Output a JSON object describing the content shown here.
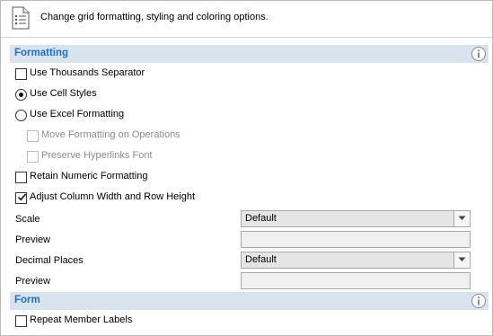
{
  "header": {
    "description": "Change grid formatting, styling and coloring options.",
    "icon": "document-list-icon"
  },
  "formatting": {
    "title": "Formatting",
    "info_icon": "info-icon",
    "options": {
      "thousands_separator": {
        "label": "Use Thousands Separator",
        "checked": false
      },
      "cell_styles": {
        "label": "Use Cell Styles",
        "selected": true
      },
      "excel_formatting": {
        "label": "Use Excel Formatting",
        "selected": false
      },
      "move_formatting": {
        "label": "Move Formatting on Operations",
        "checked": false,
        "enabled": false
      },
      "preserve_hyperlinks": {
        "label": "Preserve Hyperlinks Font",
        "checked": false,
        "enabled": false
      },
      "retain_numeric": {
        "label": "Retain Numeric Formatting",
        "checked": false
      },
      "adjust_column": {
        "label": "Adjust Column Width and Row Height",
        "checked": true
      }
    },
    "scale": {
      "label": "Scale",
      "value": "Default"
    },
    "scale_preview": {
      "label": "Preview",
      "value": ""
    },
    "decimal_places": {
      "label": "Decimal Places",
      "value": "Default"
    },
    "decimal_preview": {
      "label": "Preview",
      "value": ""
    }
  },
  "form": {
    "title": "Form",
    "info_icon": "info-icon",
    "options": {
      "repeat_member_labels": {
        "label": "Repeat Member Labels",
        "checked": false
      }
    }
  },
  "colors": {
    "section_bar": "#d8e3ee",
    "section_title": "#1f6fc4",
    "disabled_text": "#8c8c8c"
  }
}
